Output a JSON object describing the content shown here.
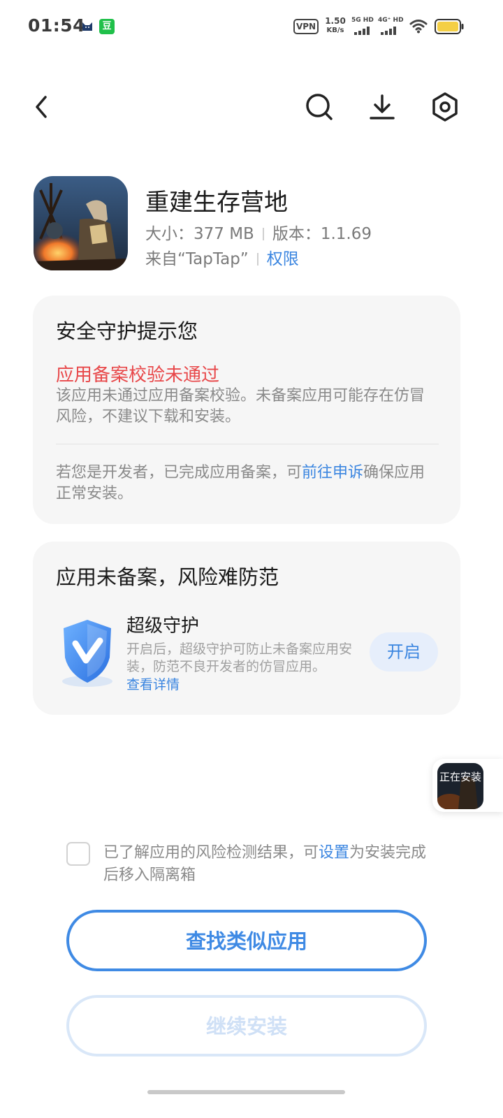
{
  "status_bar": {
    "time": "01:54",
    "dou_label": "豆",
    "vpn": "VPN",
    "speed_value": "1.50",
    "speed_unit": "KB/s",
    "sim1_label": "5G HD",
    "sim2_label": "4G⁺ HD",
    "battery_color": "#f4cf45"
  },
  "toolbar": {
    "back_icon": "chevron-left-icon",
    "search_icon": "search-icon",
    "download_icon": "download-icon",
    "settings_icon": "hexagon-gear-icon"
  },
  "app": {
    "name": "重建生存营地",
    "size": "大小：377 MB",
    "version": "版本：1.1.69",
    "source": "来自“TapTap”",
    "permissions_link": "权限"
  },
  "security_card": {
    "title": "安全守护提示您",
    "warning_title": "应用备案校验未通过",
    "warning_desc": "该应用未通过应用备案校验。未备案应用可能存在仿冒风险，不建议下载和安装。",
    "dev_prefix": "若您是开发者，已完成应用备案，可",
    "dev_link": "前往申诉",
    "dev_suffix": "确保应用正常安装。"
  },
  "protection_card": {
    "title": "应用未备案，风险难防范",
    "feature_title": "超级守护",
    "feature_desc": "开启后，超级守护可防止未备案应用安装，防范不良开发者的仿冒应用。",
    "details_link": "查看详情",
    "enable_button": "开启"
  },
  "floating_install": {
    "label": "正在安装"
  },
  "consent": {
    "text_prefix": "已了解应用的风险检测结果，可",
    "settings_link": "设置",
    "text_suffix": "为安装完成后移入隔离箱"
  },
  "buttons": {
    "find_similar": "查找类似应用",
    "continue_install": "继续安装"
  },
  "colors": {
    "accent": "#3a85e0",
    "warning": "#e8484a",
    "card_bg": "#f6f6f6"
  }
}
